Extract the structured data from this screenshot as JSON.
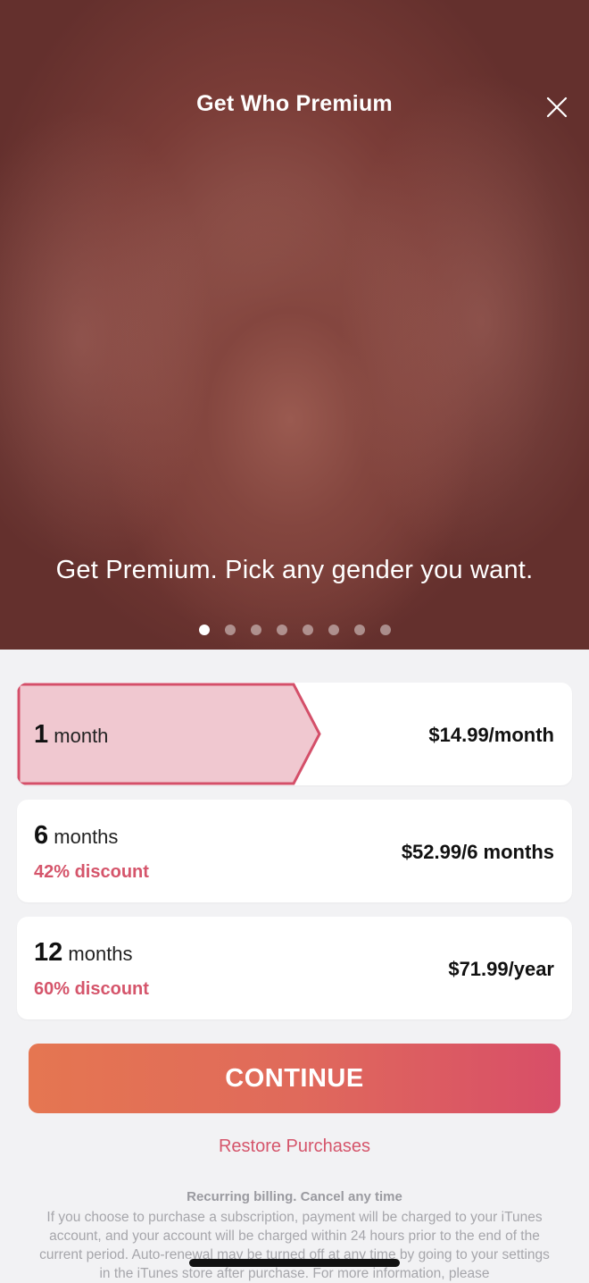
{
  "header": {
    "title": "Get Who Premium"
  },
  "hero": {
    "caption": "Get Premium. Pick any gender you want.",
    "page_count": 8,
    "active_page": 1
  },
  "plans": [
    {
      "duration_number": "1",
      "duration_unit": "month",
      "discount": "",
      "price": "$14.99/month",
      "selected": true
    },
    {
      "duration_number": "6",
      "duration_unit": "months",
      "discount": "42% discount",
      "price": "$52.99/6 months",
      "selected": false
    },
    {
      "duration_number": "12",
      "duration_unit": "months",
      "discount": "60% discount",
      "price": "$71.99/year",
      "selected": false
    }
  ],
  "continue_label": "CONTINUE",
  "restore_label": "Restore Purchases",
  "legal": {
    "title": "Recurring billing. Cancel any time",
    "body": "If you choose to purchase a subscription, payment will be charged to your iTunes account, and your account will be charged within 24 hours prior to the end of the current period. Auto-renewal may be turned off at any time by going to your settings in the iTunes store after purchase. For more information, please"
  },
  "colors": {
    "accent": "#d5556b",
    "selected_fill": "#f0c8d0",
    "selected_border": "#d44f69",
    "button_gradient_start": "#e57651",
    "button_gradient_end": "#d84e68"
  }
}
